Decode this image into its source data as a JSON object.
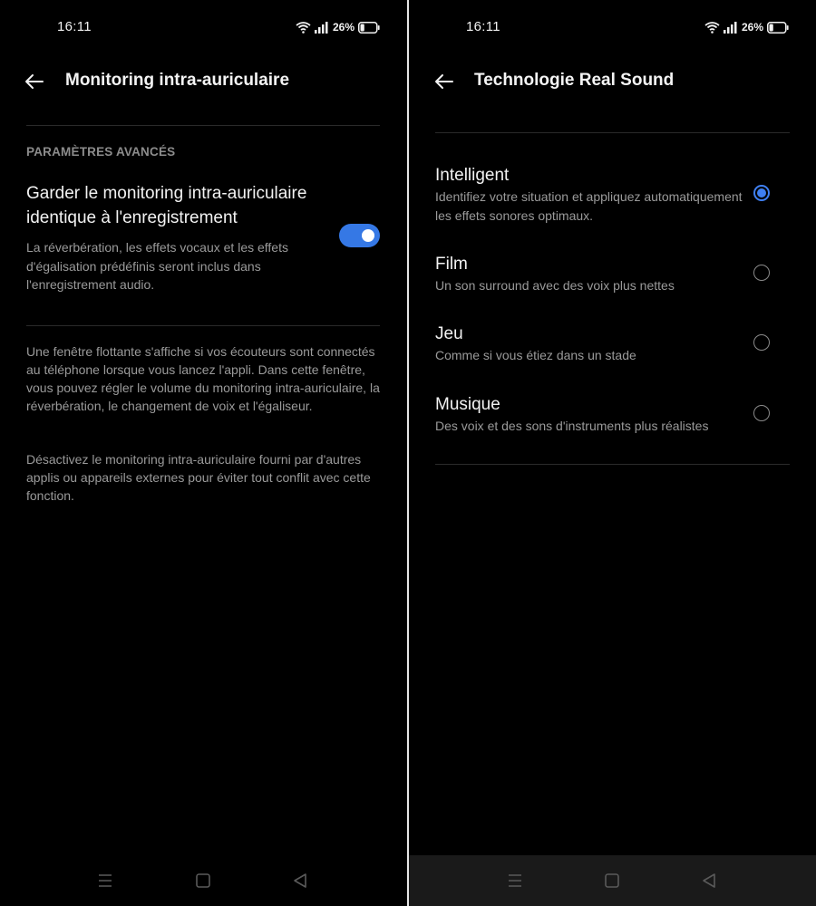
{
  "status_bar": {
    "time": "16:11",
    "battery_percent": "26%",
    "battery_level": 0.26
  },
  "left_screen": {
    "title": "Monitoring intra-auriculaire",
    "section_label": "PARAMÈTRES AVANCÉS",
    "setting": {
      "title": "Garder le monitoring intra-auriculaire identique à l'enregistrement",
      "description": "La réverbération, les effets vocaux et les effets d'égalisation prédéfinis seront inclus dans l'enregistrement audio.",
      "enabled": true
    },
    "info_paragraphs": [
      "Une fenêtre flottante s'affiche si vos écouteurs sont connectés au téléphone lorsque vous lancez l'appli. Dans cette fenêtre, vous pouvez régler le volume du monitoring intra-auriculaire, la réverbération, le changement de voix et l'égaliseur.",
      "Désactivez le monitoring intra-auriculaire fourni par d'autres applis ou appareils externes pour éviter tout conflit avec cette fonction."
    ]
  },
  "right_screen": {
    "title": "Technologie Real Sound",
    "options": [
      {
        "title": "Intelligent",
        "description": "Identifiez votre situation et appliquez automatiquement les effets sonores optimaux.",
        "selected": true
      },
      {
        "title": "Film",
        "description": "Un son surround avec des voix plus nettes",
        "selected": false
      },
      {
        "title": "Jeu",
        "description": "Comme si vous étiez dans un stade",
        "selected": false
      },
      {
        "title": "Musique",
        "description": "Des voix et des sons d'instruments plus réalistes",
        "selected": false
      }
    ]
  },
  "icons": {
    "back": "arrow-left-icon",
    "wifi": "wifi-icon",
    "signal": "signal-icon",
    "battery": "battery-icon",
    "nav_menu": "menu-icon",
    "nav_home": "square-icon",
    "nav_back": "triangle-back-icon"
  },
  "colors": {
    "accent": "#3578e5",
    "background": "#000000",
    "text_primary": "#f2f2f2",
    "text_secondary": "#9a9a9a"
  }
}
